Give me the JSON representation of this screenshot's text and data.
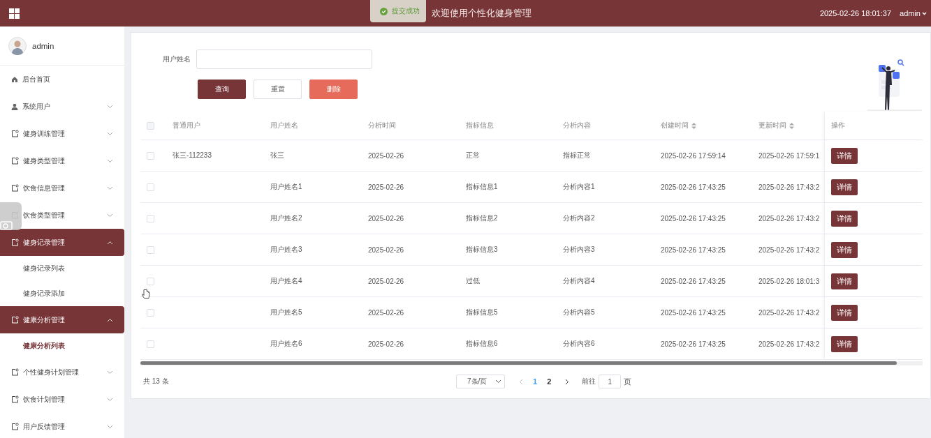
{
  "header": {
    "title": "欢迎使用个性化健身管理",
    "datetime": "2025-02-26 18:01:37",
    "user": "admin"
  },
  "toast": {
    "message": "提交成功"
  },
  "sidebar": {
    "user": "admin",
    "items": [
      {
        "label": "后台首页",
        "kind": "link"
      },
      {
        "label": "系统用户",
        "kind": "menu",
        "expanded": false
      },
      {
        "label": "健身训练管理",
        "kind": "menu",
        "expanded": false
      },
      {
        "label": "健身类型管理",
        "kind": "menu",
        "expanded": false
      },
      {
        "label": "饮食信息管理",
        "kind": "menu",
        "expanded": false
      },
      {
        "label": "饮食类型管理",
        "kind": "menu",
        "expanded": false
      },
      {
        "label": "健身记录管理",
        "kind": "menu",
        "expanded": true,
        "children": [
          {
            "label": "健身记录列表",
            "selected": false
          },
          {
            "label": "健身记录添加",
            "selected": false
          }
        ]
      },
      {
        "label": "健康分析管理",
        "kind": "menu",
        "expanded": true,
        "children": [
          {
            "label": "健康分析列表",
            "selected": true
          }
        ]
      },
      {
        "label": "个性健身计划管理",
        "kind": "menu",
        "expanded": false
      },
      {
        "label": "饮食计划管理",
        "kind": "menu",
        "expanded": false
      },
      {
        "label": "用户反馈管理",
        "kind": "menu",
        "expanded": false
      }
    ]
  },
  "search": {
    "label": "用户姓名",
    "buttons": [
      {
        "label": "查询",
        "kind": "primary"
      },
      {
        "label": "重置",
        "kind": "plain"
      },
      {
        "label": "删除",
        "kind": "danger"
      }
    ]
  },
  "table": {
    "columns": [
      {
        "label": "普通用户",
        "sortable": false
      },
      {
        "label": "用户姓名",
        "sortable": false
      },
      {
        "label": "分析时间",
        "sortable": false
      },
      {
        "label": "指标信息",
        "sortable": false
      },
      {
        "label": "分析内容",
        "sortable": false
      },
      {
        "label": "创建时间",
        "sortable": true
      },
      {
        "label": "更新时间",
        "sortable": true
      }
    ],
    "action_column": "操作",
    "all_checked": false,
    "rows": [
      {
        "cells": [
          "张三-112233",
          "张三",
          "2025-02-26",
          "正常",
          "指标正常",
          "2025-02-26 17:59:14",
          "2025-02-26 17:59:1"
        ],
        "action": "详情",
        "checked": false
      },
      {
        "cells": [
          "",
          "用户姓名1",
          "2025-02-26",
          "指标信息1",
          "分析内容1",
          "2025-02-26 17:43:25",
          "2025-02-26 17:43:2"
        ],
        "action": "详情",
        "checked": false
      },
      {
        "cells": [
          "",
          "用户姓名2",
          "2025-02-26",
          "指标信息2",
          "分析内容2",
          "2025-02-26 17:43:25",
          "2025-02-26 17:43:2"
        ],
        "action": "详情",
        "checked": false
      },
      {
        "cells": [
          "",
          "用户姓名3",
          "2025-02-26",
          "指标信息3",
          "分析内容3",
          "2025-02-26 17:43:25",
          "2025-02-26 17:43:2"
        ],
        "action": "详情",
        "checked": false
      },
      {
        "cells": [
          "",
          "用户姓名4",
          "2025-02-26",
          "过低",
          "分析内容4",
          "2025-02-26 17:43:25",
          "2025-02-26 18:01:3"
        ],
        "action": "详情",
        "checked": false
      },
      {
        "cells": [
          "",
          "用户姓名5",
          "2025-02-26",
          "指标信息5",
          "分析内容5",
          "2025-02-26 17:43:25",
          "2025-02-26 17:43:2"
        ],
        "action": "详情",
        "checked": false
      },
      {
        "cells": [
          "",
          "用户姓名6",
          "2025-02-26",
          "指标信息6",
          "分析内容6",
          "2025-02-26 17:43:25",
          "2025-02-26 17:43:2"
        ],
        "action": "详情",
        "checked": false
      }
    ]
  },
  "pagination": {
    "total": "共 13 条",
    "page_size": "7条/页",
    "pages": [
      {
        "label": "1",
        "selected": true
      },
      {
        "label": "2",
        "selected": false
      }
    ],
    "goto_label": "前往",
    "goto_value": "1",
    "goto_suffix": "页"
  }
}
